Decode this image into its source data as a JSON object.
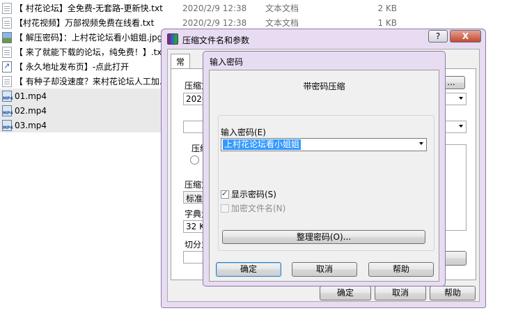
{
  "files": [
    {
      "icon": "txt",
      "name": "【 村花论坛】全免费-无套路-更新快.txt",
      "date": "2020/2/9 12:38",
      "type": "文本文档",
      "size": "2 KB"
    },
    {
      "icon": "txt",
      "name": "【村花视频】万部视频免费在线看.txt",
      "date": "2020/2/9 12:38",
      "type": "文本文档",
      "size": "1 KB"
    },
    {
      "icon": "jpg",
      "name": "【 解压密码】：上村花论坛看小姐姐.jpg",
      "date": "",
      "type": "",
      "size": ""
    },
    {
      "icon": "txt",
      "name": "【 来了就能下载的论坛，纯免费！】.txt",
      "date": "",
      "type": "",
      "size": ""
    },
    {
      "icon": "lnk",
      "name": "【 永久地址发布页】-点此打开",
      "date": "",
      "type": "",
      "size": ""
    },
    {
      "icon": "txt",
      "name": "【 有种子却没速度？来村花论坛人工加..",
      "date": "",
      "type": "",
      "size": ""
    },
    {
      "icon": "mp4",
      "name": "01.mp4",
      "date": "",
      "type": "",
      "size": ""
    },
    {
      "icon": "mp4",
      "name": "02.mp4",
      "date": "",
      "type": "",
      "size": ""
    },
    {
      "icon": "mp4",
      "name": "03.mp4",
      "date": "",
      "type": "",
      "size": ""
    }
  ],
  "outer": {
    "title": "压缩文件名和参数",
    "help": "?",
    "close": "X",
    "tab_general": "常规",
    "archive_label": "压缩文",
    "archive_value": "2020",
    "format_label": "压缩",
    "method_label": "压缩方",
    "method_value": "标准",
    "dict_label": "字典大",
    "dict_value": "32 K",
    "split_label": "切分为",
    "ok": "确定",
    "cancel": "取消",
    "help_btn": "帮助",
    "more_btn": "..."
  },
  "inner": {
    "title": "输入密码",
    "heading": "带密码压缩",
    "password_label": "输入密码(E)",
    "password_value": "上村花论坛看小姐姐",
    "show_password": "显示密码(S)",
    "show_password_checked": true,
    "encrypt_names": "加密文件名(N)",
    "encrypt_names_checked": false,
    "organize": "整理密码(O)...",
    "ok": "确定",
    "cancel": "取消",
    "help": "帮助"
  }
}
